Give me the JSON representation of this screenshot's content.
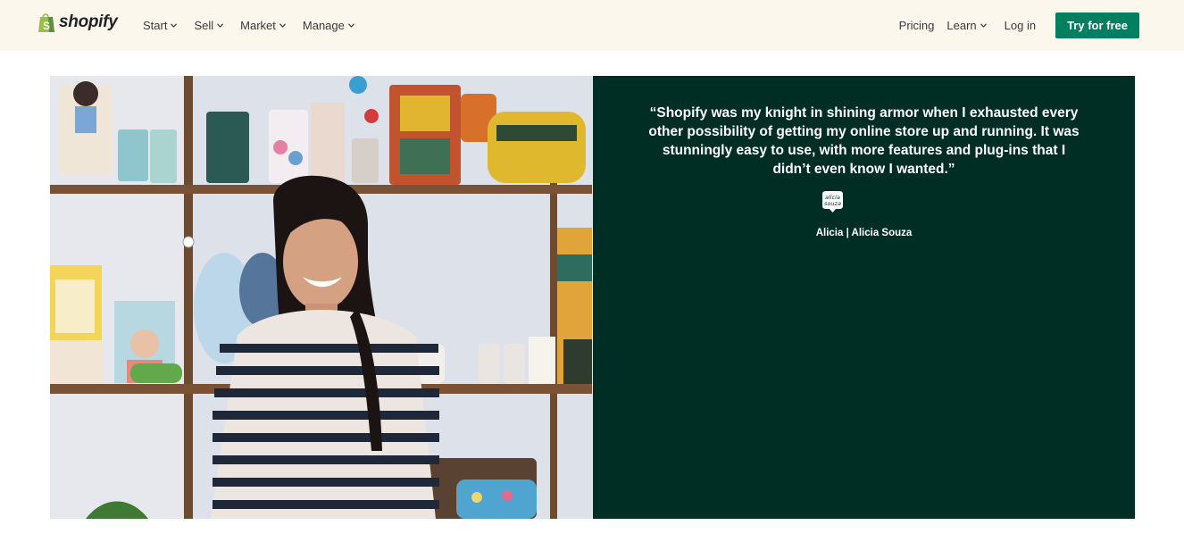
{
  "header": {
    "logo_text": "shopify",
    "nav": [
      {
        "label": "Start",
        "icon": "chevron-down-icon"
      },
      {
        "label": "Sell",
        "icon": "chevron-down-icon"
      },
      {
        "label": "Market",
        "icon": "chevron-down-icon"
      },
      {
        "label": "Manage",
        "icon": "chevron-down-icon"
      }
    ],
    "pricing_label": "Pricing",
    "learn_label": "Learn",
    "login_label": "Log in",
    "cta_label": "Try for free"
  },
  "testimonial": {
    "quote": "“Shopify was my knight in shining armor when I exhausted every other possibility of getting my online store up and running. It was stunningly easy to use, with more features and plug-ins that I didn’t even know I wanted.”",
    "brand_logo_text": "alicia souza",
    "author": "Alicia | Alicia Souza"
  },
  "colors": {
    "header_bg": "#fbf7ed",
    "brand_green": "#008060",
    "quote_panel_bg": "#002e25",
    "logo_bag_green": "#95bf47"
  }
}
